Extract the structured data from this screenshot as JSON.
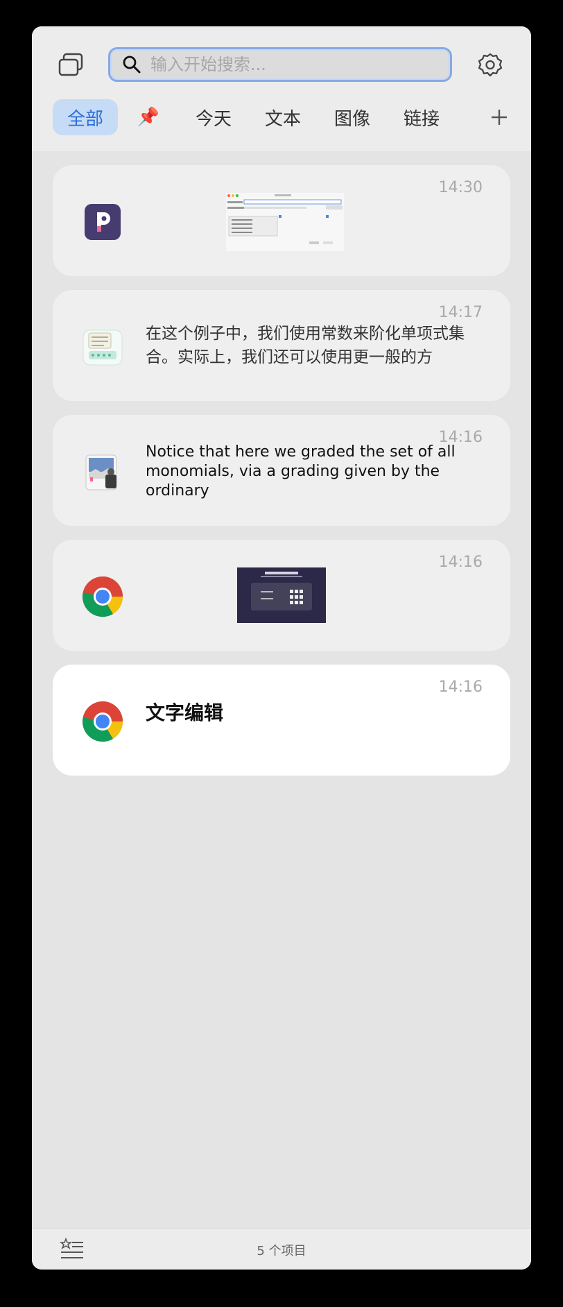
{
  "search": {
    "placeholder": "输入开始搜索..."
  },
  "tabs": [
    {
      "label": "全部",
      "active": true
    },
    {
      "label": "📌",
      "icon": "pin-icon"
    },
    {
      "label": "今天"
    },
    {
      "label": "文本"
    },
    {
      "label": "图像"
    },
    {
      "label": "链接"
    }
  ],
  "toolbar": {
    "add_label": "+"
  },
  "items": [
    {
      "time": "14:30",
      "app": "pasteapp-icon",
      "type": "image"
    },
    {
      "time": "14:17",
      "app": "notes-icon",
      "type": "text",
      "text": "在这个例子中，我们使用常数来阶化单项式集合。实际上，我们还可以使用更一般的方"
    },
    {
      "time": "14:16",
      "app": "preview-icon",
      "type": "text",
      "text": "Notice that here we graded the set of all monomials, via a grading given by the ordinary"
    },
    {
      "time": "14:16",
      "app": "chrome-icon",
      "type": "image"
    },
    {
      "time": "14:16",
      "app": "chrome-icon",
      "type": "text",
      "selected": true,
      "text": "文字编辑"
    }
  ],
  "footer": {
    "count_label": "5 个项目"
  },
  "colors": {
    "accent": "#2d6fd6",
    "tab_active_bg": "#c6dbf6",
    "search_border": "#86a9e6"
  }
}
